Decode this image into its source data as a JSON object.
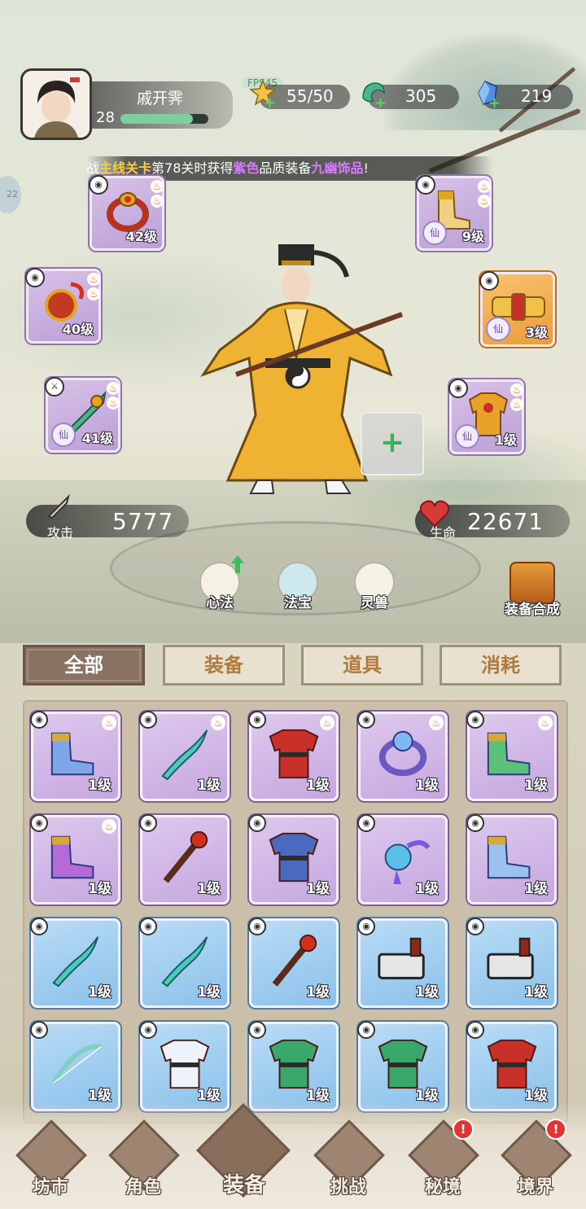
{
  "player": {
    "name": "戚开霁",
    "level": "28",
    "exp_fraction": 0.82
  },
  "fps_label": "FPS45",
  "resources": [
    {
      "name": "stamina",
      "value": "55/50",
      "icon": "star-icon"
    },
    {
      "name": "jade",
      "value": "305",
      "icon": "jade-icon"
    },
    {
      "name": "crystal",
      "value": "219",
      "icon": "crystal-icon"
    }
  ],
  "notice": {
    "p1": "战",
    "p2": "主线关卡",
    "p3": "第78关时获得",
    "p4": "紫色",
    "p5": "品质装备",
    "p6": "九幽饰品",
    "p7": "!"
  },
  "side_bubble": "22",
  "equipped": [
    {
      "slot": "ring",
      "level": "42级",
      "icon": "ring-icon"
    },
    {
      "slot": "boots",
      "level": "9级",
      "icon": "boots-icon"
    },
    {
      "slot": "amulet",
      "level": "40级",
      "icon": "amulet-icon"
    },
    {
      "slot": "belt",
      "level": "3级",
      "icon": "belt-icon"
    },
    {
      "slot": "weapon",
      "level": "41级",
      "icon": "sword-icon"
    },
    {
      "slot": "armor",
      "level": "1级",
      "icon": "armor-icon"
    }
  ],
  "stats": {
    "attack_label": "攻击",
    "attack_value": "5777",
    "hp_label": "生命",
    "hp_value": "22671"
  },
  "menu": {
    "xinfa": "心法",
    "fabao": "法宝",
    "lingshou": "灵兽",
    "synth": "装备合成"
  },
  "tabs": [
    "全部",
    "装备",
    "道具",
    "消耗"
  ],
  "inventory": [
    {
      "name": "blue-boots",
      "level": "1级",
      "rarity": "purple",
      "fire": true
    },
    {
      "name": "jade-whip",
      "level": "1级",
      "rarity": "purple",
      "fire": true
    },
    {
      "name": "red-robe",
      "level": "1级",
      "rarity": "purple",
      "fire": true
    },
    {
      "name": "blue-ring",
      "level": "1级",
      "rarity": "purple",
      "fire": true
    },
    {
      "name": "green-boots",
      "level": "1级",
      "rarity": "purple",
      "fire": true
    },
    {
      "name": "purple-boots",
      "level": "1级",
      "rarity": "purple",
      "fire": true
    },
    {
      "name": "red-staff",
      "level": "1级",
      "rarity": "purple",
      "fire": false
    },
    {
      "name": "blue-robe",
      "level": "1级",
      "rarity": "purple",
      "fire": false
    },
    {
      "name": "jade-pendant",
      "level": "1级",
      "rarity": "purple",
      "fire": false
    },
    {
      "name": "blue-boots-2",
      "level": "1级",
      "rarity": "purple",
      "fire": false
    },
    {
      "name": "jade-whip-2",
      "level": "1级",
      "rarity": "blue",
      "fire": false
    },
    {
      "name": "jade-whip-3",
      "level": "1级",
      "rarity": "blue",
      "fire": false
    },
    {
      "name": "red-staff-2",
      "level": "1级",
      "rarity": "blue",
      "fire": false
    },
    {
      "name": "cleaver",
      "level": "1级",
      "rarity": "blue",
      "fire": false
    },
    {
      "name": "cleaver-2",
      "level": "1级",
      "rarity": "blue",
      "fire": false
    },
    {
      "name": "jade-bow",
      "level": "1级",
      "rarity": "blue",
      "fire": false
    },
    {
      "name": "white-robe",
      "level": "1级",
      "rarity": "blue",
      "fire": false
    },
    {
      "name": "green-robe",
      "level": "1级",
      "rarity": "blue",
      "fire": false
    },
    {
      "name": "green-robe-2",
      "level": "1级",
      "rarity": "blue",
      "fire": false
    },
    {
      "name": "red-robe-2",
      "level": "1级",
      "rarity": "blue",
      "fire": false
    }
  ],
  "nav": [
    "坊市",
    "角色",
    "装备",
    "挑战",
    "秘境",
    "境界"
  ],
  "colors": {
    "purple_item": "#c6a7e0",
    "blue_item": "#8cc1ea",
    "accent_gold": "#ffc94a",
    "accent_purple": "#d77cff"
  }
}
